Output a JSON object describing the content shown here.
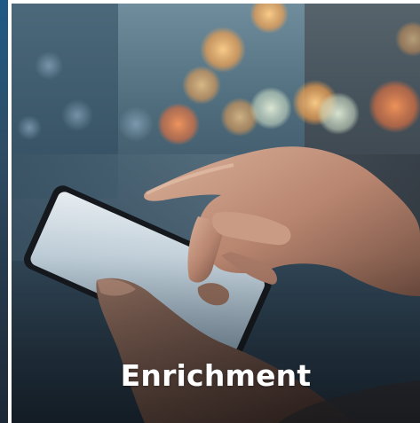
{
  "card": {
    "caption": "Enrichment"
  },
  "photo": {
    "subject": "hand-using-smartphone-photo"
  },
  "colors": {
    "caption_text": "#ffffff",
    "bokeh_warm": "#f0a050",
    "bokeh_cool": "#cfe0c8",
    "background_blue": "#2c4252"
  }
}
